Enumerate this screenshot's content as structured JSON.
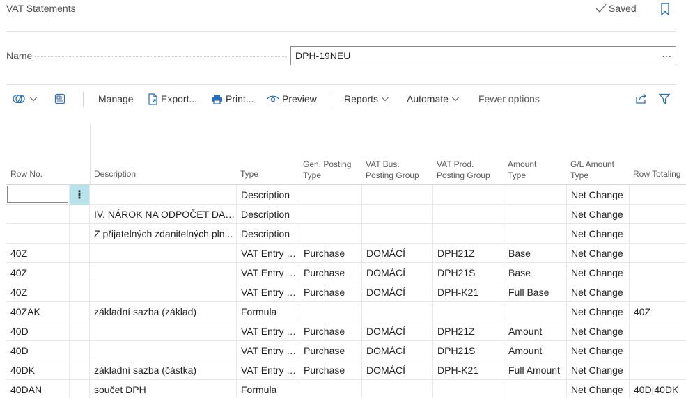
{
  "page": {
    "title": "VAT Statements",
    "saved_label": "Saved"
  },
  "name_field": {
    "label": "Name",
    "value": "DPH-19NEU",
    "more_label": "···"
  },
  "toolbar": {
    "manage": "Manage",
    "export": "Export...",
    "print": "Print...",
    "preview": "Preview",
    "reports": "Reports",
    "automate": "Automate",
    "fewer_options": "Fewer options"
  },
  "table": {
    "headers": {
      "row_no": "Row No.",
      "description": "Description",
      "type": "Type",
      "gen_posting_type_1": "Gen. Posting",
      "gen_posting_type_2": "Type",
      "vat_bus_1": "VAT Bus.",
      "vat_bus_2": "Posting Group",
      "vat_prod_1": "VAT Prod.",
      "vat_prod_2": "Posting Group",
      "amount_type_1": "Amount",
      "amount_type_2": "Type",
      "gl_amount_type_1": "G/L Amount",
      "gl_amount_type_2": "Type",
      "row_totaling": "Row Totaling"
    },
    "row_menu_label": "⋮",
    "rows": [
      {
        "row_no": "",
        "description": "",
        "type": "Description",
        "gen": "",
        "vbus": "",
        "vprod": "",
        "amt": "",
        "gl": "Net Change",
        "tot": ""
      },
      {
        "row_no": "",
        "description": "IV. NÁROK NA ODPOČET DANĚ",
        "type": "Description",
        "gen": "",
        "vbus": "",
        "vprod": "",
        "amt": "",
        "gl": "Net Change",
        "tot": ""
      },
      {
        "row_no": "",
        "description": "Z přijatelných zdanitelných pln...",
        "type": "Description",
        "gen": "",
        "vbus": "",
        "vprod": "",
        "amt": "",
        "gl": "Net Change",
        "tot": ""
      },
      {
        "row_no": "40Z",
        "description": "",
        "type": "VAT Entry T...",
        "gen": "Purchase",
        "vbus": "DOMÁCÍ",
        "vprod": "DPH21Z",
        "amt": "Base",
        "gl": "Net Change",
        "tot": ""
      },
      {
        "row_no": "40Z",
        "description": "",
        "type": "VAT Entry T...",
        "gen": "Purchase",
        "vbus": "DOMÁCÍ",
        "vprod": "DPH21S",
        "amt": "Base",
        "gl": "Net Change",
        "tot": ""
      },
      {
        "row_no": "40Z",
        "description": "",
        "type": "VAT Entry T...",
        "gen": "Purchase",
        "vbus": "DOMÁCÍ",
        "vprod": "DPH-K21",
        "amt": "Full Base",
        "gl": "Net Change",
        "tot": ""
      },
      {
        "row_no": "40ZAK",
        "description": "základní sazba (základ)",
        "type": "Formula",
        "gen": "",
        "vbus": "",
        "vprod": "",
        "amt": "",
        "gl": "Net Change",
        "tot": "40Z"
      },
      {
        "row_no": "40D",
        "description": "",
        "type": "VAT Entry T...",
        "gen": "Purchase",
        "vbus": "DOMÁCÍ",
        "vprod": "DPH21Z",
        "amt": "Amount",
        "gl": "Net Change",
        "tot": ""
      },
      {
        "row_no": "40D",
        "description": "",
        "type": "VAT Entry T...",
        "gen": "Purchase",
        "vbus": "DOMÁCÍ",
        "vprod": "DPH21S",
        "amt": "Amount",
        "gl": "Net Change",
        "tot": ""
      },
      {
        "row_no": "40DK",
        "description": "základní sazba (částka)",
        "type": "VAT Entry T...",
        "gen": "Purchase",
        "vbus": "DOMÁCÍ",
        "vprod": "DPH-K21",
        "amt": "Full Amount",
        "gl": "Net Change",
        "tot": ""
      },
      {
        "row_no": "40DAN",
        "description": "součet DPH",
        "type": "Formula",
        "gen": "",
        "vbus": "",
        "vprod": "",
        "amt": "",
        "gl": "Net Change",
        "tot": "40D|40DK"
      }
    ]
  }
}
